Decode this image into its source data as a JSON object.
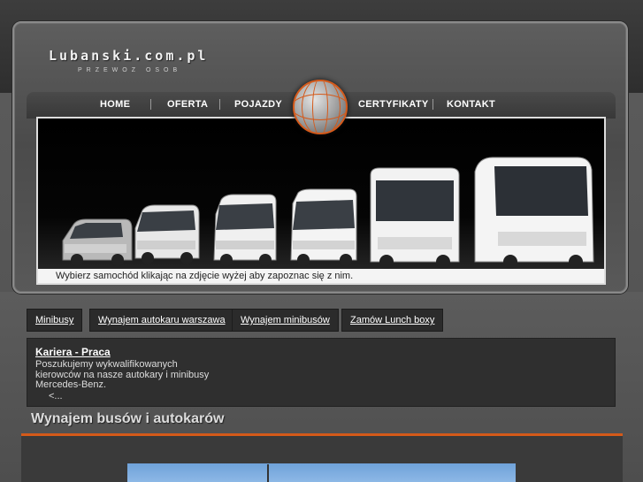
{
  "site": {
    "logo_text": "Lubanski.com.pl",
    "logo_subtitle": "PRZEWOZ OSOB"
  },
  "nav": {
    "items": [
      {
        "label": "HOME"
      },
      {
        "label": "OFERTA"
      },
      {
        "label": "POJAZDY"
      },
      {
        "label": "CERTYFIKATY"
      },
      {
        "label": "KONTAKT"
      }
    ]
  },
  "banner": {
    "caption": "Wybierz samochód klikając na zdjęcie wyżej aby zapoznac się z nim.",
    "vehicles": [
      "van",
      "minibus",
      "minibus",
      "minibus",
      "bus",
      "coach"
    ]
  },
  "links": [
    {
      "label": "Minibusy"
    },
    {
      "label": "Wynajem autokaru warszawa"
    },
    {
      "label": "Wynajem minibusów"
    },
    {
      "label": "Zamów Lunch boxy"
    }
  ],
  "news": {
    "title": "Kariera - Praca",
    "body": "Poszukujemy wykwalifikowanych kierowców na nasze autokary i minibusy Mercedes-Benz.",
    "more": "<..."
  },
  "section": {
    "title": "Wynajem busów i autokarów"
  },
  "colors": {
    "accent": "#d45a1a",
    "background": "#3a3a3a",
    "panel": "#2b2b2b"
  }
}
